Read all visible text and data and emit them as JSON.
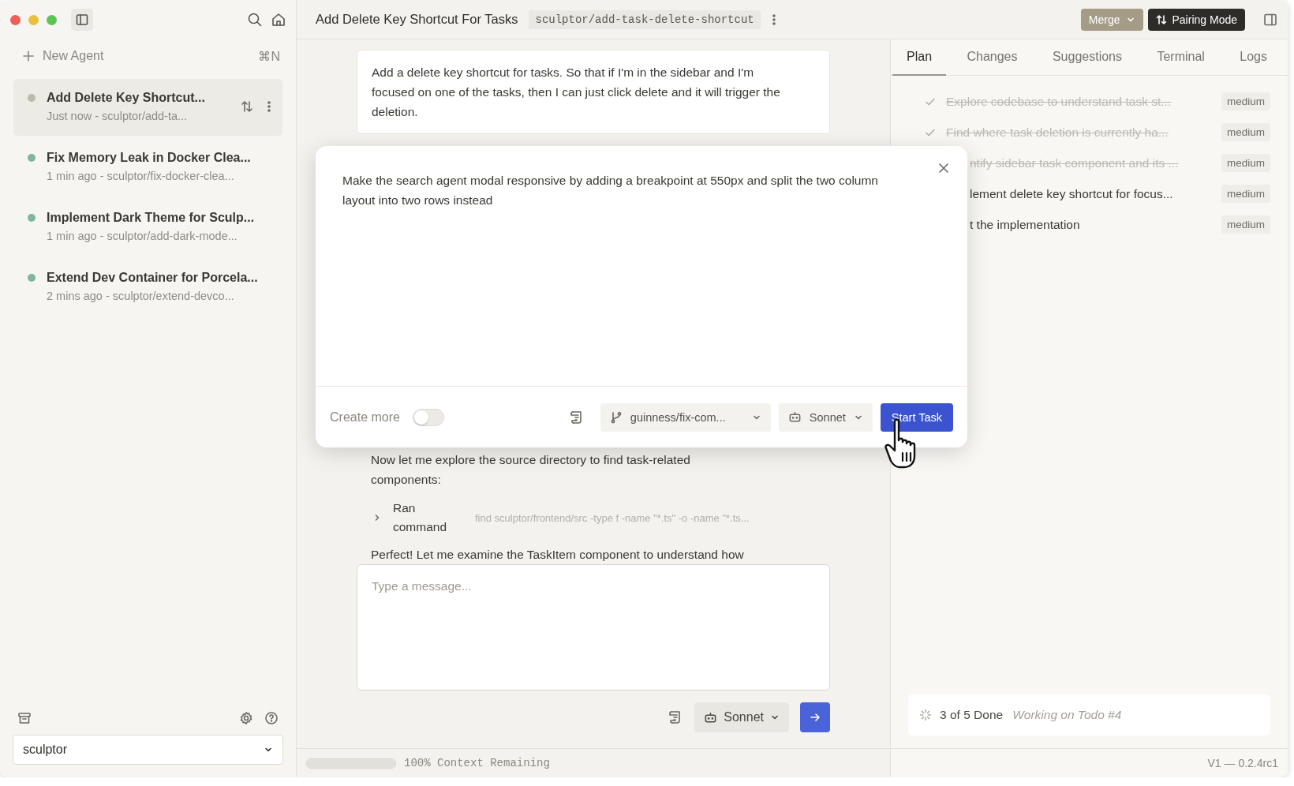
{
  "sidebar": {
    "new_agent": {
      "label": "New Agent",
      "shortcut": "⌘N"
    },
    "agents": [
      {
        "title": "Add Delete Key Shortcut...",
        "subtitle": "Just now - sculptor/add-ta...",
        "color": "#bdb9ab",
        "selected": true
      },
      {
        "title": "Fix Memory Leak in Docker Clea...",
        "subtitle": "1 min ago - sculptor/fix-docker-clea...",
        "color": "#7fb69c",
        "selected": false
      },
      {
        "title": "Implement Dark Theme for Sculp...",
        "subtitle": "1 min ago - sculptor/add-dark-mode...",
        "color": "#7fb69c",
        "selected": false
      },
      {
        "title": "Extend Dev Container for Porcela...",
        "subtitle": "2 mins ago - sculptor/extend-devco...",
        "color": "#7fb69c",
        "selected": false
      }
    ],
    "project_select": {
      "value": "sculptor"
    }
  },
  "header": {
    "title": "Add Delete Key Shortcut For Tasks",
    "branch": "sculptor/add-task-delete-shortcut",
    "buttons": [
      {
        "label": "Merge",
        "kind": "merge"
      },
      {
        "label": "Pairing Mode",
        "kind": "pairing"
      }
    ]
  },
  "chat": {
    "messages": [
      {
        "kind": "user",
        "text": "Add a delete key shortcut for tasks. So that if I'm in the sidebar and I'm focused on one of the tasks, then I can just click delete and it will trigger the deletion."
      },
      {
        "kind": "assistant",
        "text": "Now let me explore the source directory to find task-related components:"
      },
      {
        "kind": "command",
        "label": "Ran command",
        "command": "find sculptor/frontend/src -type f -name \"*.ts\" -o -name \"*.ts..."
      },
      {
        "kind": "assistant",
        "text": "Perfect! Let me examine the TaskItem component to understand how"
      }
    ],
    "input": {
      "placeholder": "Type a message..."
    },
    "model": "Sonnet",
    "context": {
      "label": "100% Context Remaining",
      "level": 1
    }
  },
  "modal": {
    "text": "Make the search agent modal responsive by adding a breakpoint at 550px and split the two column layout into two rows instead",
    "create_more": {
      "label": "Create more",
      "on": false
    },
    "branch": "guinness/fix-com...",
    "model": "Sonnet",
    "submit": "Start Task"
  },
  "plan_panel": {
    "tabs": [
      {
        "label": "Plan",
        "selected": true
      },
      {
        "label": "Changes",
        "selected": false
      },
      {
        "label": "Suggestions",
        "selected": false
      },
      {
        "label": "Terminal",
        "selected": false
      },
      {
        "label": "Logs",
        "selected": false
      }
    ],
    "todos": [
      {
        "kind": "full",
        "text": "Explore codebase to understand task st...",
        "done": true,
        "priority": "medium"
      },
      {
        "kind": "full",
        "text": "Find where task deletion is currently ha...",
        "done": true,
        "priority": "medium"
      },
      {
        "kind": "cut",
        "text": "ntify sidebar task component and its ...",
        "done": true,
        "priority": "medium"
      },
      {
        "kind": "cut",
        "text": "lement delete key shortcut for focus...",
        "done": false,
        "priority": "medium"
      },
      {
        "kind": "cut",
        "text": "t the implementation",
        "done": false,
        "priority": "medium"
      }
    ],
    "status": {
      "count": "3 of 5 Done",
      "detail": "Working on Todo #4"
    },
    "version": "V1 — 0.2.4rc1"
  }
}
